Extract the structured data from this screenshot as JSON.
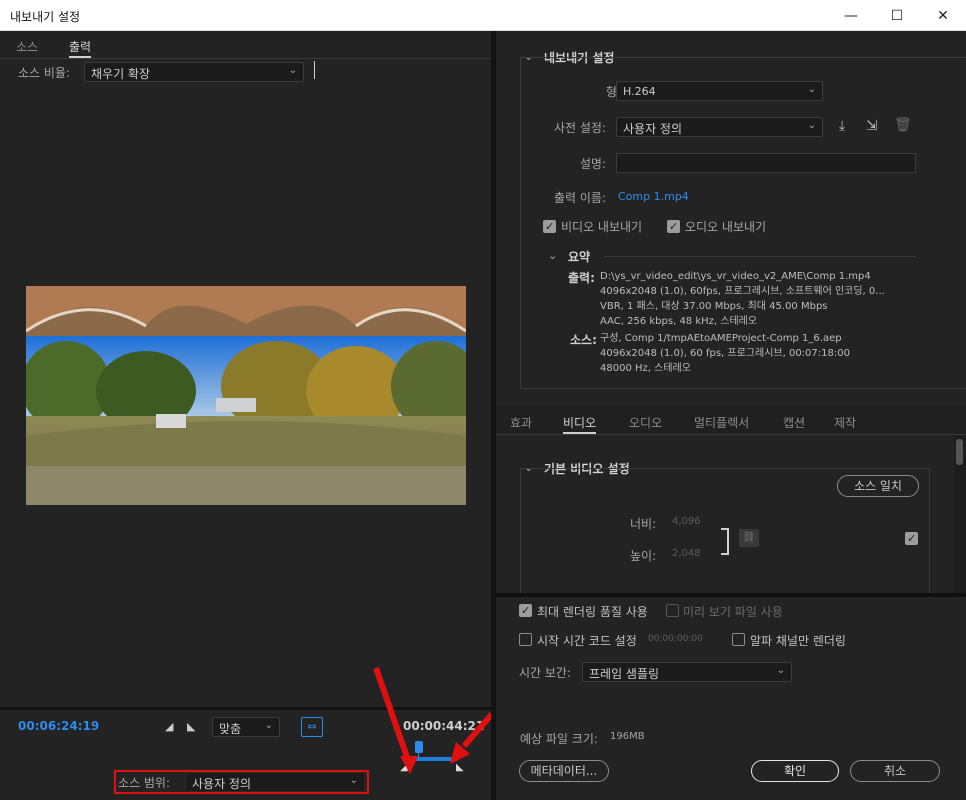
{
  "window": {
    "title": "내보내기 설정",
    "minimize": "—",
    "maximize": "☐",
    "close": "✕"
  },
  "left": {
    "tabs": [
      "소스",
      "출력"
    ],
    "source_ratio_label": "소스 비율:",
    "source_ratio_value": "채우기 확장",
    "timecode_start": "00:06:24:19",
    "timecode_end": "00:00:44:21",
    "fit_value": "맞춤",
    "source_range_label": "소스 범위:",
    "source_range_value": "사용자 정의"
  },
  "export": {
    "section_title": "내보내기 설정",
    "format_label": "형식:",
    "format_value": "H.264",
    "preset_label": "사전 설정:",
    "preset_value": "사용자 정의",
    "comment_label": "설명:",
    "comment_value": "",
    "output_label": "출력 이름:",
    "output_value": "Comp 1.mp4",
    "export_video": "비디오 내보내기",
    "export_audio": "오디오 내보내기",
    "summary_title": "요약",
    "out_head": "출력:",
    "out_lines": [
      "D:\\ys_vr_video_edit\\ys_vr_video_v2_AME\\Comp 1.mp4",
      "4096x2048 (1.0), 60fps, 프로그레시브, 소프트웨어 인코딩, 0...",
      "VBR, 1 패스, 대상 37.00 Mbps, 최대 45.00 Mbps",
      "AAC, 256 kbps, 48 kHz, 스테레오"
    ],
    "src_head": "소스:",
    "src_lines": [
      "구성, Comp 1/tmpAEtoAMEProject-Comp 1_6.aep",
      "4096x2048 (1.0), 60 fps, 프로그레시브, 00:07:18:00",
      "48000 Hz, 스테레오"
    ]
  },
  "settings_tabs": [
    "효과",
    "비디오",
    "오디오",
    "멀티플렉서",
    "캡션",
    "제작"
  ],
  "video": {
    "section_title": "기본 비디오 설정",
    "match_source": "소스 일치",
    "width_label": "너비:",
    "width_value": "4,096",
    "height_label": "높이:",
    "height_value": "2,048"
  },
  "bottom": {
    "max_render": "최대 렌더링 품질 사용",
    "use_preview": "미리 보기 파일 사용",
    "start_tc": "시작 시간 코드 설정",
    "start_tc_value": "00:00:00:00",
    "alpha_only": "알파 채널만 렌더링",
    "interp_label": "시간 보간:",
    "interp_value": "프레임 샘플링",
    "est_label": "예상 파일 크기:",
    "est_value": "196MB",
    "metadata": "메타데이터...",
    "ok": "확인",
    "cancel": "취소"
  },
  "colors": {
    "accent": "#2d8ceb",
    "annotation": "#e01010"
  }
}
